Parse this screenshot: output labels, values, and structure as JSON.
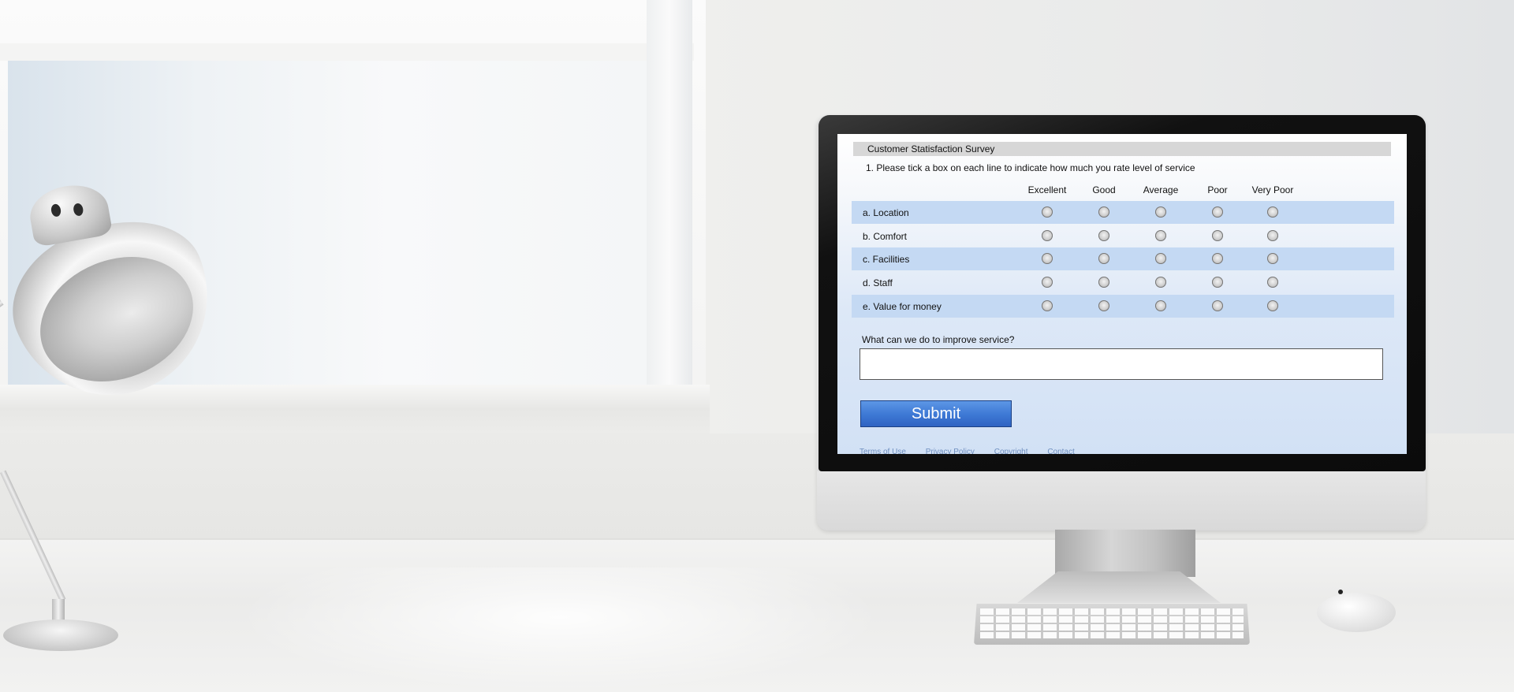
{
  "survey": {
    "title": "Customer Statisfaction Survey",
    "question": "1. Please tick a box on each line to indicate how much you rate level of service",
    "columns": [
      "Excellent",
      "Good",
      "Average",
      "Poor",
      "Very Poor"
    ],
    "rows": [
      {
        "label": "a. Location"
      },
      {
        "label": "b. Comfort"
      },
      {
        "label": "c. Facilities"
      },
      {
        "label": "d. Staff"
      },
      {
        "label": "e. Value for money"
      }
    ],
    "improve_label": "What can we do to improve service?",
    "improve_value": "",
    "submit_label": "Submit",
    "footer_links": [
      "Terms of Use",
      "Privacy Policy",
      "Copyright",
      "Contact"
    ]
  },
  "colors": {
    "row_shade": "#c4d9f3",
    "submit_button": "#3f7ad6",
    "title_bar": "#d7d7d7"
  }
}
